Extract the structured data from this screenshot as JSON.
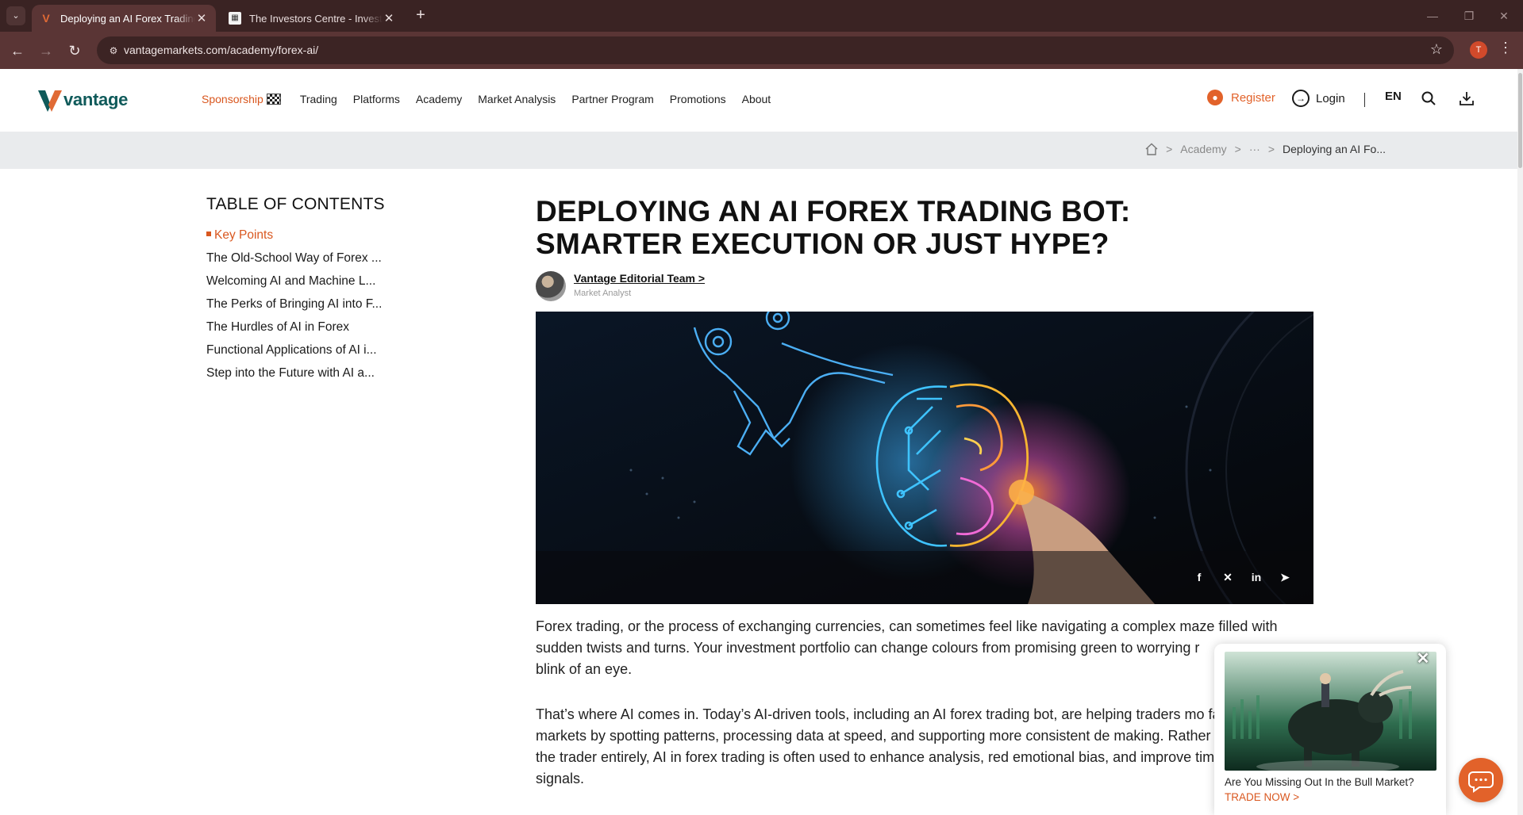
{
  "browser": {
    "tabs": [
      {
        "title": "Deploying an AI Forex Trading Bot",
        "active": true
      },
      {
        "title": "The Investors Centre - Investing",
        "active": false
      }
    ],
    "url": "vantagemarkets.com/academy/forex-ai/",
    "profile_initial": "T",
    "new_tab": "+",
    "close_glyph": "✕"
  },
  "site": {
    "brand": "vantage",
    "nav": [
      "Sponsorship",
      "Trading",
      "Platforms",
      "Academy",
      "Market Analysis",
      "Partner Program",
      "Promotions",
      "About"
    ],
    "register": "Register",
    "login": "Login",
    "language": "EN",
    "accent_color": "#d9571f",
    "brand_color": "#0f5a5a"
  },
  "breadcrumb": {
    "items": [
      "Academy",
      "···"
    ],
    "current": "Deploying an AI Fo...",
    "separator": ">"
  },
  "toc": {
    "heading": "TABLE OF CONTENTS",
    "items": [
      "Key Points",
      "The Old-School Way of Forex ...",
      "Welcoming AI and Machine L...",
      "The Perks of Bringing AI into F...",
      "The Hurdles of AI in Forex",
      "Functional Applications of AI i...",
      "Step into the Future with AI a..."
    ]
  },
  "article": {
    "title": "DEPLOYING AN AI FOREX TRADING BOT: SMARTER EXECUTION OR JUST HYPE?",
    "author": "Vantage Editorial Team >",
    "author_role": "Market Analyst",
    "share_icons": [
      "facebook-icon",
      "x-icon",
      "linkedin-icon",
      "telegram-icon"
    ],
    "paragraphs": [
      "Forex trading, or the process of exchanging currencies, can sometimes feel like navigating a complex maze filled with sudden twists and turns. Your investment portfolio can change colours from promising green to worrying r",
      "That’s where AI comes in. Today’s AI-driven tools, including an AI forex trading bot, are helping traders mo fast-moving markets by spotting patterns, processing data at speed, and supporting more consistent de making. Rather than replacing the trader entirely, AI in forex trading is often used to enhance analysis, red emotional bias, and improve timing with clearer signals."
    ],
    "paragraph1_tail": "blink of an eye."
  },
  "popup": {
    "text": "Are You Missing Out In the Bull Market?",
    "cta": "TRADE NOW >"
  }
}
